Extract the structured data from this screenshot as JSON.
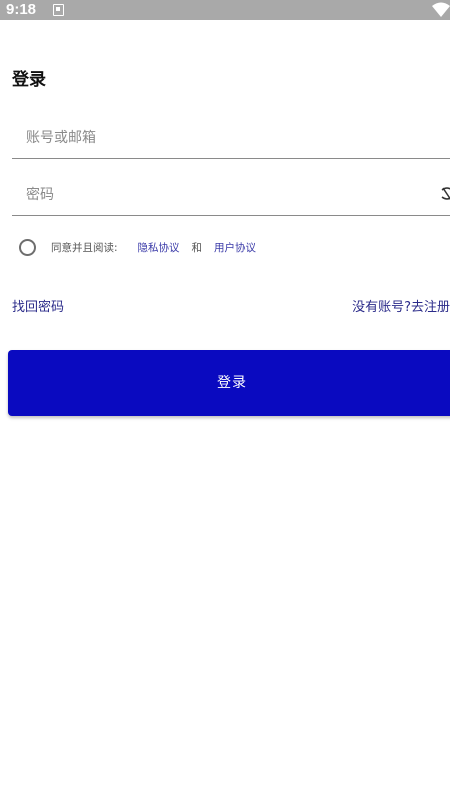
{
  "status_bar": {
    "time": "9:18",
    "notification_icon": "notification-icon",
    "wifi_icon": "wifi-icon"
  },
  "page": {
    "title": "登录"
  },
  "form": {
    "account_placeholder": "账号或邮箱",
    "account_value": "",
    "password_placeholder": "密码",
    "password_value": "",
    "password_toggle_icon": "eye-off-icon"
  },
  "agreement": {
    "checked": false,
    "prefix": "同意并且阅读:",
    "privacy_link": "隐私协议",
    "and": "和",
    "user_link": "用户协议"
  },
  "links": {
    "forgot_password": "找回密码",
    "register": "没有账号?去注册"
  },
  "actions": {
    "login_button": "登录"
  },
  "colors": {
    "primary": "#0a0ac0",
    "link": "#2b2b8a",
    "status_bar": "#a9a9a9"
  }
}
